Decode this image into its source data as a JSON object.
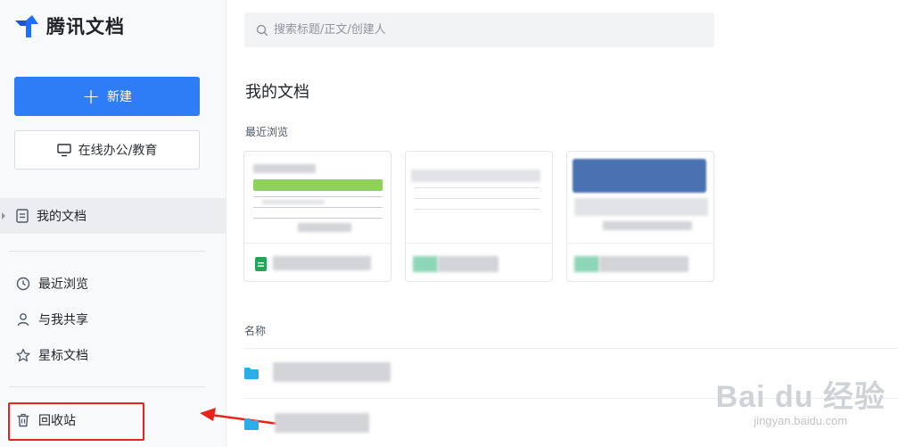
{
  "app": {
    "name": "腾讯文档"
  },
  "sidebar": {
    "new_label": "新建",
    "online_label": "在线办公/教育",
    "items": [
      {
        "key": "my-docs",
        "label": "我的文档",
        "icon": "document-icon",
        "active": true
      },
      {
        "key": "recent",
        "label": "最近浏览",
        "icon": "clock-icon",
        "active": false
      },
      {
        "key": "shared",
        "label": "与我共享",
        "icon": "user-icon",
        "active": false
      },
      {
        "key": "starred",
        "label": "星标文档",
        "icon": "star-icon",
        "active": false
      },
      {
        "key": "trash",
        "label": "回收站",
        "icon": "trash-icon",
        "active": false
      }
    ]
  },
  "search": {
    "placeholder": "搜索标题/正文/创建人",
    "value": ""
  },
  "main": {
    "title": "我的文档",
    "recent_label": "最近浏览",
    "name_label": "名称"
  },
  "watermark": {
    "main": "Bai du 经验",
    "sub": "jingyan.baidu.com"
  },
  "colors": {
    "accent": "#2e7cf6",
    "sheet_green": "#23a55a",
    "folder_blue": "#2aaee8",
    "annotation_red": "#e8231a"
  }
}
